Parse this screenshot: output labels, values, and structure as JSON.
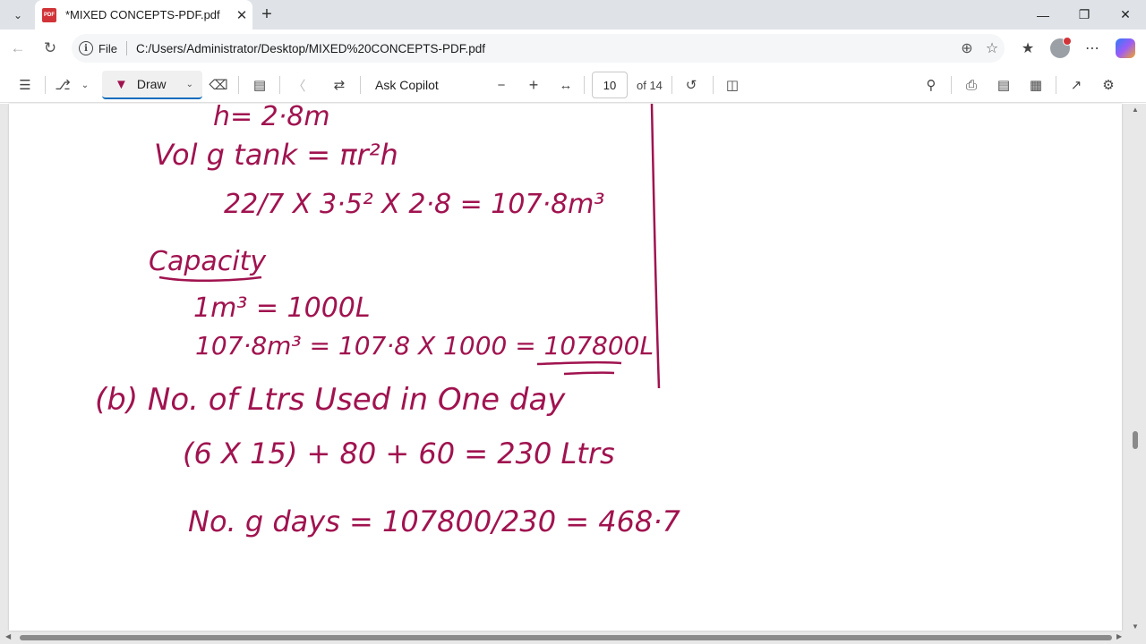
{
  "tab": {
    "title": "*MIXED CONCEPTS-PDF.pdf",
    "icon_label": "PDF"
  },
  "address": {
    "scheme_label": "File",
    "url": "C:/Users/Administrator/Desktop/MIXED%20CONCEPTS-PDF.pdf"
  },
  "toolbar": {
    "draw_label": "Draw",
    "copilot_label": "Ask Copilot",
    "current_page": "10",
    "page_count": "of 14"
  },
  "document": {
    "lines": [
      "h= 2·8m",
      "Vol g tank = πr²h",
      "22/7 X 3·5² X 2·8 = 107·8m³",
      "Capacity",
      "1m³ = 1000L",
      "107·8m³ = 107·8 X 1000 = 107800L",
      "(b) No. of Ltrs Used in One day",
      "(6 X 15) + 80 + 60 = 230 Ltrs",
      "No. g days = 107800/230 = 468·7"
    ],
    "ink_color": "#a0134f"
  },
  "colors": {
    "accent": "#0f6cbd",
    "ink": "#a0134f"
  }
}
